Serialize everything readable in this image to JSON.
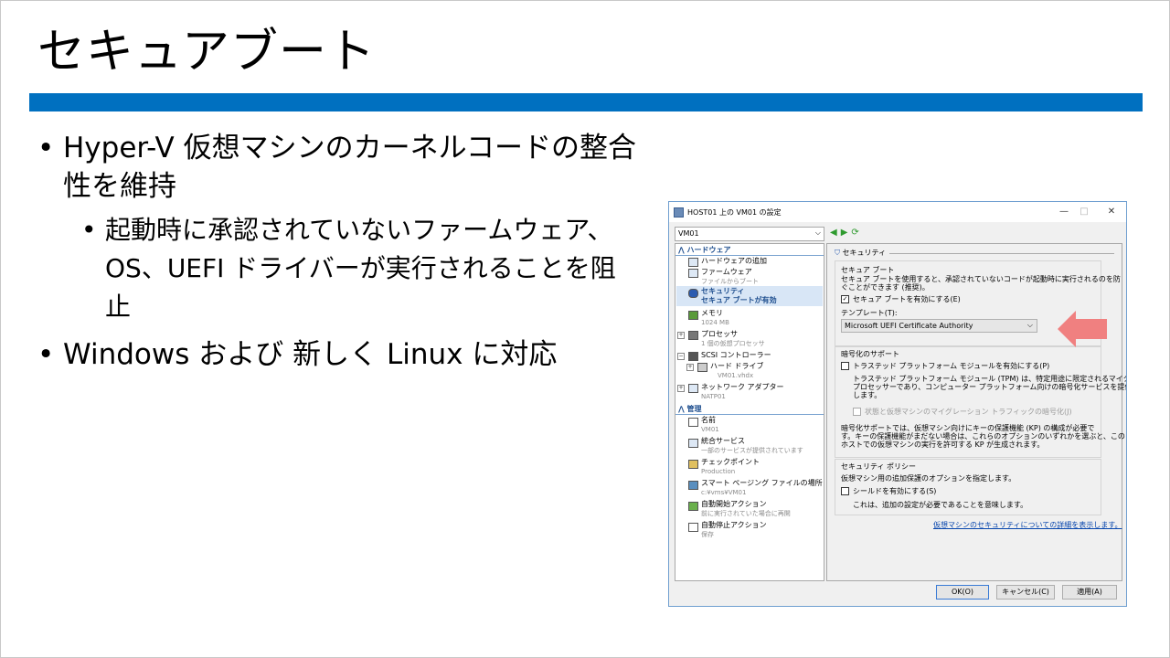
{
  "slide": {
    "title": "セキュアブート",
    "bullets": [
      {
        "text": "Hyper-V 仮想マシンのカーネルコードの整合性を維持",
        "sub": [
          "起動時に承認されていないファームウェア、OS、UEFI ドライバーが実行されることを阻止"
        ]
      },
      {
        "text": "Windows および 新しく Linux に対応",
        "sub": []
      }
    ]
  },
  "dialog": {
    "title": "HOST01 上の VM01 の設定",
    "controls": {
      "minimize": "—",
      "maximize": "□",
      "close": "✕"
    },
    "vm_select": "VM01",
    "tree": {
      "hardware_label": "ハードウェア",
      "management_label": "管理",
      "hardware": [
        {
          "label": "ハードウェアの追加",
          "sub": ""
        },
        {
          "label": "ファームウェア",
          "sub": "ファイルからブート"
        },
        {
          "label": "セキュリティ",
          "sub": "セキュア ブートが有効"
        },
        {
          "label": "メモリ",
          "sub": "1024 MB"
        },
        {
          "label": "プロセッサ",
          "sub": "1 個の仮想プロセッサ"
        },
        {
          "label": "SCSI コントローラー",
          "sub": ""
        },
        {
          "label": "ハード ドライブ",
          "sub": "VM01.vhdx"
        },
        {
          "label": "ネットワーク アダプター",
          "sub": "NATP01"
        }
      ],
      "management": [
        {
          "label": "名前",
          "sub": "VM01"
        },
        {
          "label": "統合サービス",
          "sub": "一部のサービスが提供されています"
        },
        {
          "label": "チェックポイント",
          "sub": "Production"
        },
        {
          "label": "スマート ページング ファイルの場所",
          "sub": "c:¥vms¥VM01"
        },
        {
          "label": "自動開始アクション",
          "sub": "前に実行されていた場合に再開"
        },
        {
          "label": "自動停止アクション",
          "sub": "保存"
        }
      ]
    },
    "panel": {
      "heading": "セキュリティ",
      "secure_boot": {
        "title": "セキュア ブート",
        "desc1": "セキュア ブートを使用すると、承認されていないコードが起動時に実行されるのを防",
        "desc2": "ぐことができます (推奨)。",
        "enable_label": "セキュア ブートを有効にする(E)",
        "enable_checked": true,
        "template_label": "テンプレート(T):",
        "template_value": "Microsoft UEFI Certificate Authority"
      },
      "encryption": {
        "title": "暗号化のサポート",
        "tpm_label": "トラステッド プラットフォーム モジュールを有効にする(P)",
        "tpm_desc1": "トラステッド プラットフォーム モジュール (TPM) は、特定用途に限定されるマイクロ",
        "tpm_desc2": "プロセッサーであり、コンピューター プラットフォーム向けの暗号化サービスを提供",
        "tpm_desc3": "します。",
        "migration_label": "状態と仮想マシンのマイグレーション トラフィックの暗号化(J)",
        "note1": "暗号化サポートでは、仮想マシン向けにキーの保護機能 (KP) の構成が必要で",
        "note2": "す。キーの保護機能がまだない場合は、これらのオプションのいずれかを選ぶと、この",
        "note3": "ホストでの仮想マシンの実行を許可する KP が生成されます。"
      },
      "policy": {
        "title": "セキュリティ ポリシー",
        "desc": "仮想マシン用の追加保護のオプションを指定します。",
        "shield_label": "シールドを有効にする(S)",
        "shield_note": "これは、追加の設定が必要であることを意味します。"
      },
      "link": "仮想マシンのセキュリティについての詳細を表示します。"
    },
    "buttons": {
      "ok": "OK(O)",
      "cancel": "キャンセル(C)",
      "apply": "適用(A)"
    }
  },
  "colors": {
    "accent_bar": "#0070c0",
    "callout_arrow": "#f08080"
  }
}
